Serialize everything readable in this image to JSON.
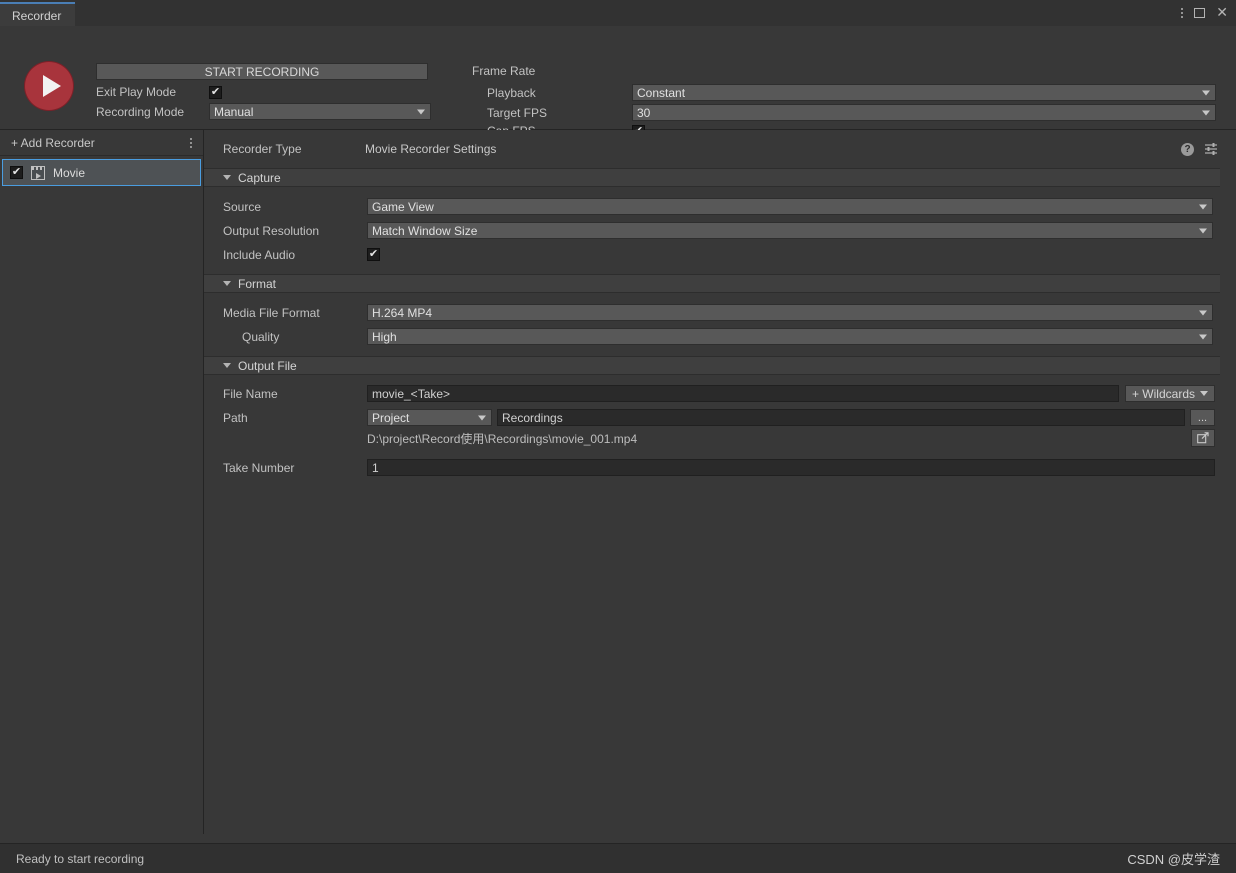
{
  "window": {
    "tab_label": "Recorder",
    "menu_icon": "kebab-menu-icon",
    "maximize_icon": "maximize-icon",
    "close_icon": "close-icon"
  },
  "topbar": {
    "record_icon": "play-record-icon",
    "start_recording_label": "START RECORDING",
    "exit_play_mode_label": "Exit Play Mode",
    "exit_play_mode_checked": "✔",
    "recording_mode_label": "Recording Mode",
    "recording_mode_value": "Manual",
    "frame_rate_label": "Frame Rate",
    "playback_label": "Playback",
    "playback_value": "Constant",
    "target_fps_label": "Target FPS",
    "target_fps_value": "30",
    "cap_fps_label": "Cap FPS",
    "cap_fps_checked": "✔"
  },
  "sidebar": {
    "add_recorder_label": "+ Add Recorder",
    "options_icon": "kebab-menu-icon",
    "recorders": [
      {
        "name": "Movie",
        "enabled_check": "✔",
        "icon": "movie-clapper-icon"
      }
    ]
  },
  "inspector": {
    "recorder_type_label": "Recorder Type",
    "recorder_type_value": "Movie Recorder Settings",
    "help_icon": "help-question-icon",
    "preset_icon": "preset-sliders-icon",
    "capture": {
      "title": "Capture",
      "source_label": "Source",
      "source_value": "Game View",
      "output_resolution_label": "Output Resolution",
      "output_resolution_value": "Match Window Size",
      "include_audio_label": "Include Audio",
      "include_audio_checked": "✔"
    },
    "format": {
      "title": "Format",
      "media_file_format_label": "Media File Format",
      "media_file_format_value": "H.264 MP4",
      "quality_label": "Quality",
      "quality_value": "High"
    },
    "output_file": {
      "title": "Output File",
      "file_name_label": "File Name",
      "file_name_value": "movie_<Take>",
      "wildcards_label": "+ Wildcards",
      "path_label": "Path",
      "path_root_value": "Project",
      "path_sub_value": "Recordings",
      "browse_label": "...",
      "reveal_icon": "open-external-icon",
      "resolved_path": "D:\\project\\Record使用\\Recordings\\movie_001.mp4",
      "take_number_label": "Take Number",
      "take_number_value": "1"
    }
  },
  "statusbar": {
    "message": "Ready to start recording",
    "watermark": "CSDN @皮学渣"
  },
  "colors": {
    "record_red": "#a8343c",
    "selection_blue": "#4a9de0",
    "tab_accent": "#4a7eb5",
    "panel_bg": "#383838"
  }
}
